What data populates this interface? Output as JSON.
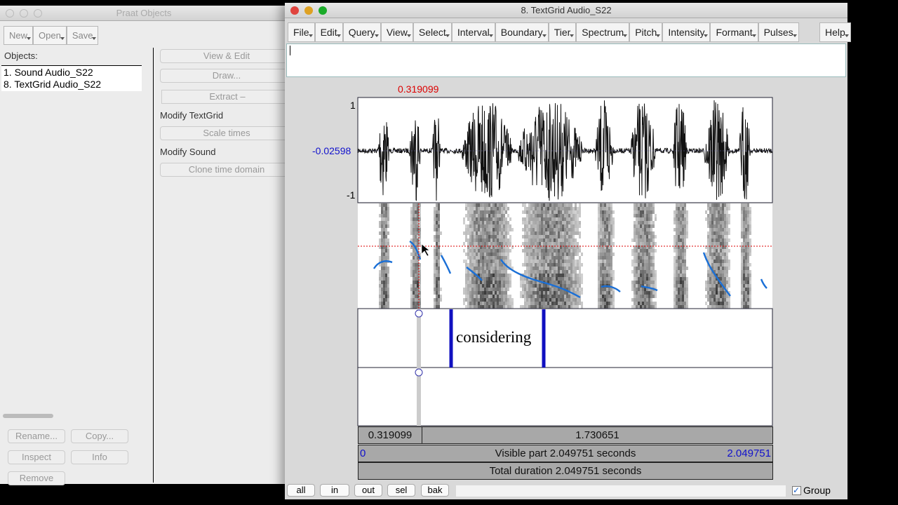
{
  "objects_window": {
    "title": "Praat Objects",
    "toolbar": [
      "New",
      "Open",
      "Save"
    ],
    "objects_label": "Objects:",
    "objects": [
      "1. Sound Audio_S22",
      "8. TextGrid Audio_S22"
    ],
    "actions": {
      "view_edit": "View & Edit",
      "draw": "Draw...",
      "extract": "Extract –",
      "modify_textgrid": "Modify TextGrid",
      "scale_times": "Scale times",
      "modify_sound": "Modify Sound",
      "clone_time_domain": "Clone time domain"
    },
    "bottom": {
      "rename": "Rename...",
      "copy": "Copy...",
      "inspect": "Inspect",
      "info": "Info",
      "remove": "Remove"
    }
  },
  "editor": {
    "title": "8. TextGrid Audio_S22",
    "menus": [
      "File",
      "Edit",
      "Query",
      "View",
      "Select",
      "Interval",
      "Boundary",
      "Tier",
      "Spectrum",
      "Pitch",
      "Intensity",
      "Formant",
      "Pulses"
    ],
    "help": "Help",
    "text_field": "",
    "cursor_time": "0.319099",
    "amp_max": "1",
    "amp_cursor": "-0.02598",
    "amp_min": "-1",
    "interval_label": "considering",
    "sel_left": "0.319099",
    "sel_right": "1.730651",
    "visible_start": "0",
    "visible_label": "Visible part 2.049751 seconds",
    "visible_end": "2.049751",
    "total_label": "Total duration 2.049751 seconds",
    "buttons": [
      "all",
      "in",
      "out",
      "sel",
      "bak"
    ],
    "group_label": "Group",
    "group_checked": true,
    "colors": {
      "cursor": "#dd0000",
      "pitch": "#1a6fd6",
      "boundary": "#1010c0"
    }
  }
}
